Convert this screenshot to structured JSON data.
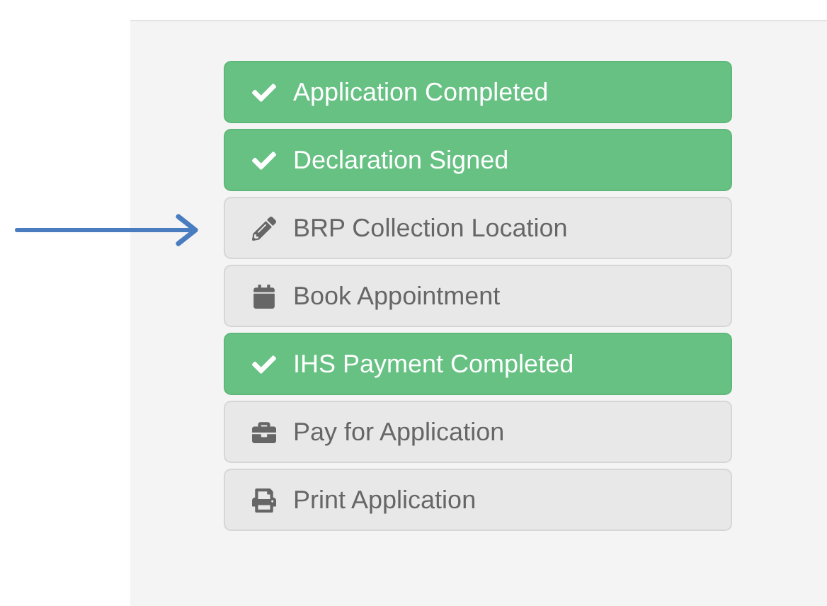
{
  "steps": [
    {
      "label": "Application Completed",
      "completed": true,
      "kind": "check"
    },
    {
      "label": "Declaration Signed",
      "completed": true,
      "kind": "check"
    },
    {
      "label": "BRP Collection Location",
      "completed": false,
      "kind": "pencil"
    },
    {
      "label": "Book Appointment",
      "completed": false,
      "kind": "calendar"
    },
    {
      "label": "IHS Payment Completed",
      "completed": true,
      "kind": "check"
    },
    {
      "label": "Pay for Application",
      "completed": false,
      "kind": "briefcase"
    },
    {
      "label": "Print Application",
      "completed": false,
      "kind": "printer"
    }
  ]
}
